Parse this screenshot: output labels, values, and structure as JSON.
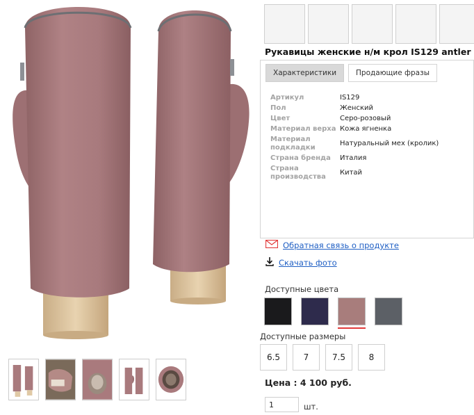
{
  "product": {
    "title": "Рукавицы женские н/м крол IS129 antler"
  },
  "tabs": [
    {
      "label": "Характеристики",
      "active": true
    },
    {
      "label": "Продающие фразы",
      "active": false
    }
  ],
  "specs": [
    {
      "label": "Артикул",
      "value": "IS129"
    },
    {
      "label": "Пол",
      "value": "Женский"
    },
    {
      "label": "Цвет",
      "value": "Серо-розовый"
    },
    {
      "label": "Материал верха",
      "value": "Кожа ягненка"
    },
    {
      "label": "Материал подкладки",
      "value": "Натуральный мех (кролик)"
    },
    {
      "label": "Страна бренда",
      "value": "Италия"
    },
    {
      "label": "Страна производства",
      "value": "Китай"
    }
  ],
  "links": {
    "feedback": {
      "label": "Обратная связь о продукте",
      "icon": "envelope-icon"
    },
    "download": {
      "label": "Скачать фото",
      "icon": "download-icon"
    }
  },
  "colors": {
    "label": "Доступные цвета",
    "options": [
      {
        "name": "black",
        "hex": "#1a1a1c",
        "selected": false
      },
      {
        "name": "navy",
        "hex": "#2e2b4c",
        "selected": false
      },
      {
        "name": "antler",
        "hex": "#a87d7c",
        "selected": true
      },
      {
        "name": "grey",
        "hex": "#5c6066",
        "selected": false
      }
    ]
  },
  "sizes": {
    "label": "Доступные размеры",
    "options": [
      "6.5",
      "7",
      "7.5",
      "8"
    ]
  },
  "price": {
    "text": "Цена : 4 100 руб."
  },
  "quantity": {
    "value": "1",
    "unit": "шт."
  },
  "theme": {
    "link_color": "#1f5fc4",
    "mitten_color": "#a97a7d",
    "selected_marker": "#e23a3a"
  }
}
